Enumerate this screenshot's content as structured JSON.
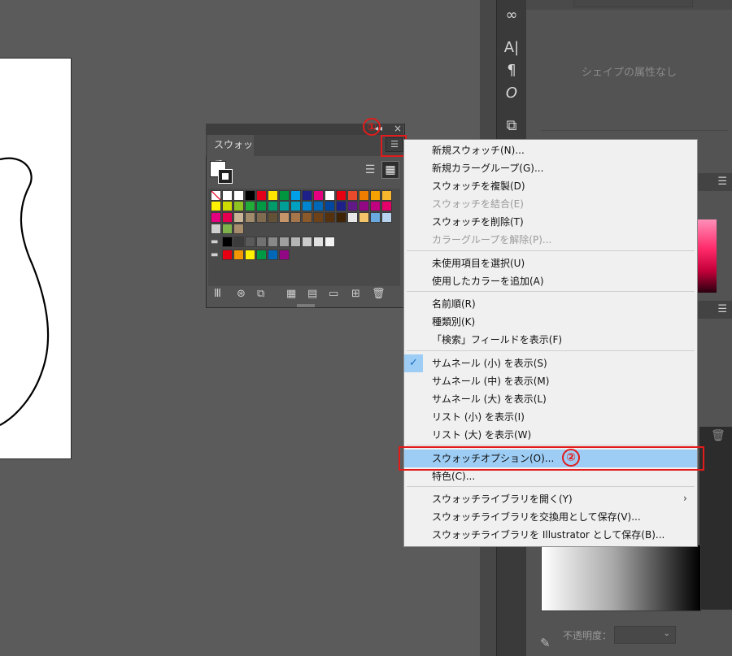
{
  "properties_panel": {
    "no_attributes_text": "シェイプの属性なし",
    "opacity_label": "不透明度："
  },
  "tool_strip": {
    "icons": [
      "link-icon",
      "character-icon",
      "paragraph-icon",
      "opentype-icon",
      "pathfinder-icon"
    ],
    "glyphs": [
      "∞",
      "A|",
      "¶",
      "O",
      "⧉"
    ]
  },
  "swatches_panel": {
    "tab_label": "スウォッチ",
    "menu_glyph": "☰",
    "list_view_glyph": "☰",
    "thumb_view_glyph": "▦",
    "collapse_glyph": "◂◂",
    "close_glyph": "×",
    "swatch_rows": [
      [
        "none",
        "#ffffff",
        "#ffffff",
        "#000000",
        "#e3001b",
        "#ffe600",
        "#00963f",
        "#00a0e9",
        "#1d2088",
        "#e4007f",
        "#ffffff",
        "#e60012",
        "#e94a2c",
        "#ef7d00",
        "#f5a200",
        "#f8b62d"
      ],
      [
        "#fff100",
        "#cfdb00",
        "#8fc31f",
        "#22ac38",
        "#009944",
        "#009b6b",
        "#009e96",
        "#00a0c1",
        "#0086d1",
        "#0068b7",
        "#00479d",
        "#1d2088",
        "#601986",
        "#920783",
        "#be0081",
        "#e5006a"
      ],
      [
        "#e4007f",
        "#e5004f",
        "#c9b495",
        "#a08b6b",
        "#7f6b4f",
        "#625037",
        "#c7956a",
        "#a6764a",
        "#8a5a2b",
        "#6e4219",
        "#55320d",
        "#3f2306",
        "#e8e8e8",
        "#f3c46a",
        "#6aa9e0",
        "#b7d3f0"
      ],
      [
        "#cfcfcf",
        "#7fb24a",
        "#a88d6d"
      ],
      [
        "folder",
        "#000000",
        "#3c3c3c",
        "#5a5a5a",
        "#717171",
        "#898989",
        "#9f9f9f",
        "#b5b5b5",
        "#cbcbcb",
        "#e0e0e0",
        "#f2f2f2"
      ],
      [
        "folder",
        "#e60012",
        "#f39800",
        "#fff100",
        "#009944",
        "#0068b7",
        "#920783"
      ]
    ],
    "toolbar_glyphs": [
      "Ⅲ",
      "⊛",
      "⧉",
      "▦",
      "▤",
      "▭",
      "⊞",
      "🗑"
    ],
    "toolbar_icons": [
      "swatch-libraries-menu-icon",
      "add-to-library-icon",
      "place-swatches-icon",
      "show-swatch-kinds-icon",
      "swatch-options-icon",
      "new-color-group-icon",
      "new-swatch-icon",
      "delete-swatch-icon"
    ]
  },
  "annotations": {
    "badge_1": "①",
    "badge_2": "②"
  },
  "menu": {
    "check_glyph": "✓",
    "arrow_glyph": "›",
    "items": [
      {
        "label": "新規スウォッチ(N)...",
        "enabled": true
      },
      {
        "label": "新規カラーグループ(G)...",
        "enabled": true
      },
      {
        "label": "スウォッチを複製(D)",
        "enabled": true
      },
      {
        "label": "スウォッチを結合(E)",
        "enabled": false
      },
      {
        "label": "スウォッチを削除(T)",
        "enabled": true
      },
      {
        "label": "カラーグループを解除(P)...",
        "enabled": false
      },
      {
        "label": "未使用項目を選択(U)",
        "enabled": true
      },
      {
        "label": "使用したカラーを追加(A)",
        "enabled": true
      },
      {
        "label": "名前順(R)",
        "enabled": true
      },
      {
        "label": "種類別(K)",
        "enabled": true
      },
      {
        "label": "「検索」フィールドを表示(F)",
        "enabled": true
      },
      {
        "label": "サムネール (小) を表示(S)",
        "enabled": true,
        "checked": true
      },
      {
        "label": "サムネール (中) を表示(M)",
        "enabled": true
      },
      {
        "label": "サムネール (大) を表示(L)",
        "enabled": true
      },
      {
        "label": "リスト (小) を表示(I)",
        "enabled": true
      },
      {
        "label": "リスト (大) を表示(W)",
        "enabled": true
      },
      {
        "label": "スウォッチオプション(O)...",
        "enabled": true,
        "hovered": true
      },
      {
        "label": "特色(C)...",
        "enabled": true
      },
      {
        "label": "スウォッチライブラリを開く(Y)",
        "enabled": true,
        "submenu": true
      },
      {
        "label": "スウォッチライブラリを交換用として保存(V)...",
        "enabled": true
      },
      {
        "label": "スウォッチライブラリを Illustrator として保存(B)...",
        "enabled": true
      }
    ]
  },
  "colors": {
    "highlight_red": "#e21b1b",
    "hover_blue": "#9dcdf5"
  }
}
